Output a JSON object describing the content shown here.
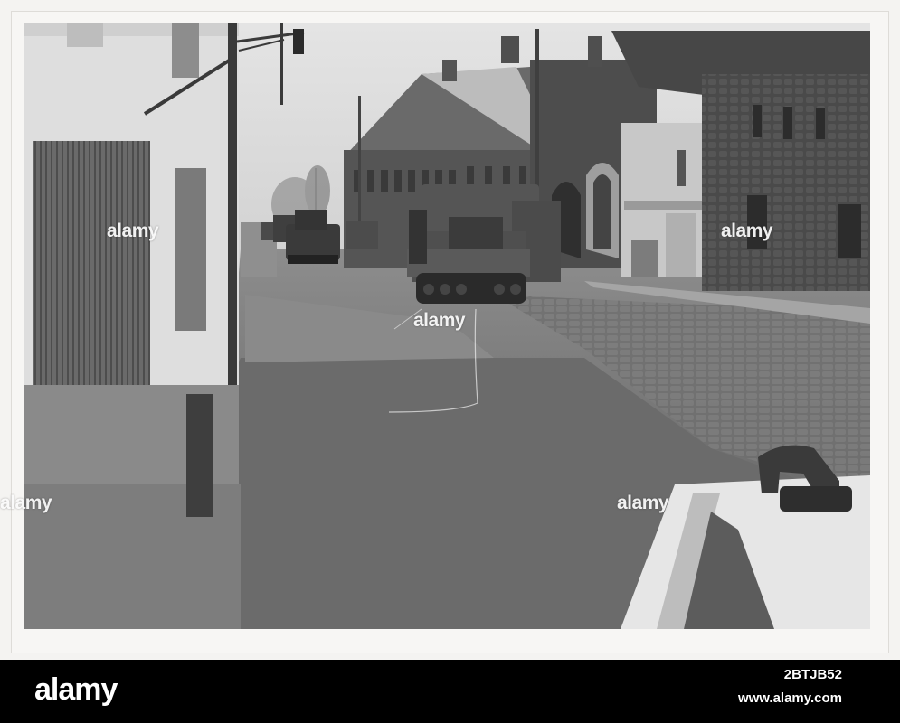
{
  "watermark": {
    "text": "alamy"
  },
  "footer": {
    "logo": "alamy",
    "image_id": "2BTJB52",
    "url": "www.alamy.com"
  }
}
